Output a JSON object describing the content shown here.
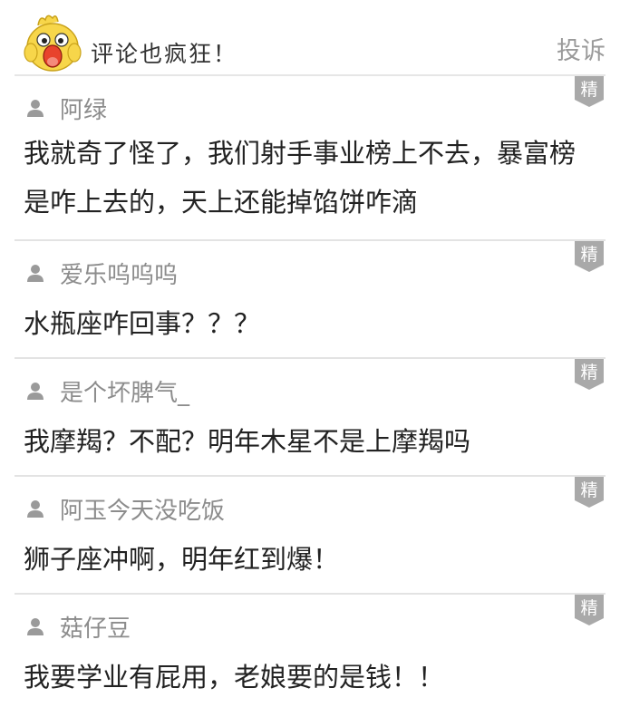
{
  "header": {
    "title": "评论也疯狂！",
    "report_label": "投诉"
  },
  "badge_label": "精",
  "colors": {
    "badge": "#a9a9a9",
    "username": "#8c8c8c",
    "divider": "#e3e3e3",
    "mascot_yellow": "#f7d64a"
  },
  "comments": [
    {
      "user": "阿绿",
      "text": "我就奇了怪了，我们射手事业榜上不去，暴富榜是咋上去的，天上还能掉馅饼咋滴"
    },
    {
      "user": "爱乐呜呜呜",
      "text": "水瓶座咋回事？？？"
    },
    {
      "user": "是个坏脾气_",
      "text": "我摩羯？不配？明年木星不是上摩羯吗"
    },
    {
      "user": "阿玉今天没吃饭",
      "text": "狮子座冲啊，明年红到爆！"
    },
    {
      "user": "菇仔豆",
      "text": "我要学业有屁用，老娘要的是钱！！"
    }
  ]
}
